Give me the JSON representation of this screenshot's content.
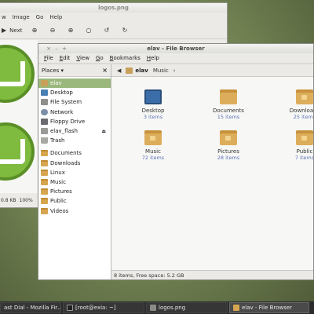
{
  "viewer": {
    "title": "logos.png",
    "menu": [
      "w",
      "Image",
      "Go",
      "Help"
    ],
    "toolbar": {
      "next_label": "Next"
    },
    "status": {
      "size": "0.8 KB",
      "zoom": "100%"
    }
  },
  "file_browser": {
    "title": "elav - File Browser",
    "window_buttons": [
      "×",
      "–",
      "+"
    ],
    "menu": [
      "File",
      "Edit",
      "View",
      "Go",
      "Bookmarks",
      "Help"
    ],
    "sidebar": {
      "header": "Places",
      "close": "×",
      "items": [
        {
          "label": "elav",
          "icon": "home-icon",
          "selected": true
        },
        {
          "label": "Desktop",
          "icon": "desktop-icon"
        },
        {
          "label": "File System",
          "icon": "drive-icon"
        },
        {
          "label": "Network",
          "icon": "network-icon"
        },
        {
          "label": "Floppy Drive",
          "icon": "floppy-icon"
        },
        {
          "label": "elav_flash",
          "icon": "usb-icon",
          "eject": "⏏"
        },
        {
          "label": "Trash",
          "icon": "trash-icon"
        }
      ],
      "bookmarks": [
        "Documents",
        "Downloads",
        "Linux",
        "Music",
        "Pictures",
        "Public",
        "Videos"
      ]
    },
    "pathbar": {
      "back": "◀",
      "home": "elav",
      "current": "Music",
      "more": "›"
    },
    "items": [
      {
        "name": "Desktop",
        "count": "3 items",
        "icon": "desktop-icon"
      },
      {
        "name": "Documents",
        "count": "15 items",
        "icon": "folder-icon"
      },
      {
        "name": "Downloads",
        "count": "25 items",
        "icon": "folder-downloads-icon"
      },
      {
        "name": "Music",
        "count": "72 items",
        "icon": "folder-music-icon"
      },
      {
        "name": "Pictures",
        "count": "28 items",
        "icon": "folder-pictures-icon"
      },
      {
        "name": "Public",
        "count": "7 items",
        "icon": "folder-public-icon"
      }
    ],
    "status": "8 items, Free space: 5.2 GB"
  },
  "taskbar": [
    {
      "label": "ast Dial - Mozilla Fir…",
      "icon": "firefox-icon"
    },
    {
      "label": "[root@exia: ~]",
      "icon": "terminal-icon"
    },
    {
      "label": "logos.png",
      "icon": "image-icon"
    },
    {
      "label": "elav - File Browser",
      "icon": "file-browser-icon",
      "active": true
    }
  ],
  "colors": {
    "selection": "#9ab87c",
    "count_text": "#5e73b8",
    "folder": "#dcae5b",
    "desktop_bg": "#6f7f50",
    "mint_green": "#7ebb3e"
  }
}
